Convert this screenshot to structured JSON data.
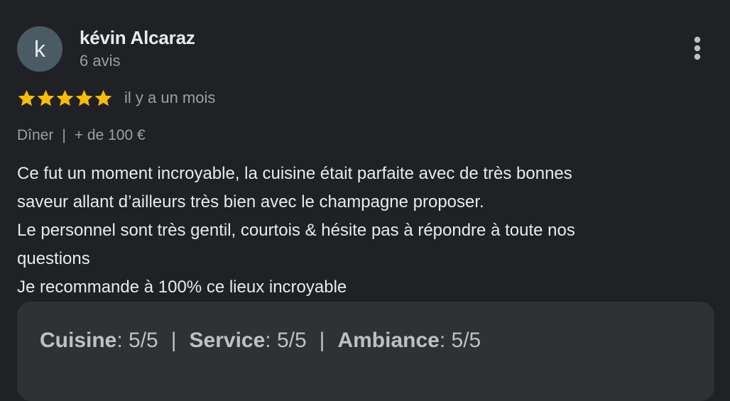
{
  "reviewer": {
    "avatar_letter": "k",
    "name": "kévin Alcaraz",
    "review_count": "6 avis"
  },
  "more_icon": "vertical-dots-icon",
  "rating": {
    "stars": 5,
    "max_stars": 5,
    "star_color": "#fbbc04",
    "time_ago": "il y a un mois"
  },
  "meta": {
    "meal": "Dîner",
    "separator": "|",
    "price": "+ de 100 €"
  },
  "review": {
    "lines": [
      "Ce fut un moment incroyable, la cuisine était parfaite avec de très bonnes",
      "saveur allant d’ailleurs très bien avec le champagne proposer.",
      "Le personnel sont très gentil, courtois & hésite pas à répondre à toute nos",
      "questions",
      "Je recommande à 100% ce lieux incroyable"
    ]
  },
  "sub_ratings": {
    "separator": "|",
    "items": [
      {
        "label": "Cuisine",
        "value": " : 5/5"
      },
      {
        "label": "Service",
        "value": " : 5/5"
      },
      {
        "label": "Ambiance",
        "value": " : 5/5"
      }
    ]
  }
}
